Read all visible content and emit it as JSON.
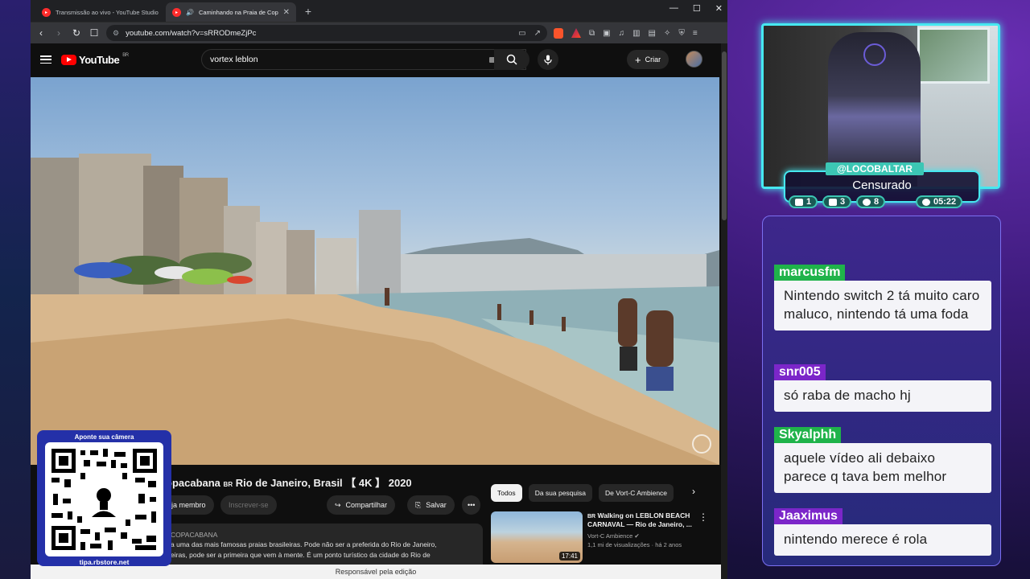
{
  "browser": {
    "tabs": [
      {
        "title": "Transmissão ao vivo - YouTube Studio",
        "active": false
      },
      {
        "title": "Caminhando na Praia de Copacabana",
        "active": true
      }
    ],
    "url": "youtube.com/watch?v=sRRODmeZjPc"
  },
  "youtube": {
    "logo_text": "YouTube",
    "region": "BR",
    "search_value": "vortex leblon",
    "create_label": "Criar",
    "video": {
      "title_prefix": "opacabana",
      "title_flag": "BR",
      "title_suffix": "Rio de Janeiro, Brasil 【 4K 】 2020",
      "member_label": "eja membro",
      "subscribe_label": "Inscrever-se",
      "share_label": "Compartilhar",
      "save_label": "Salvar",
      "desc_channel": "COPACABANA",
      "desc_line1": "a uma das mais famosas praias brasileiras. Pode não ser a preferida do Rio de Janeiro,",
      "desc_line2": "eiras, pode ser a primeira que vem à mente. É um ponto turístico da cidade do Rio de"
    },
    "chips": [
      "Todos",
      "Da sua pesquisa",
      "De Vort-C Ambience"
    ],
    "recommendation": {
      "flag": "BR",
      "title": "Walking on LEBLON BEACH CARNAVAL — Rio de Janeiro, ...",
      "channel": "Vort-C Ambience",
      "meta": "1,1 mi de visualizações · há 2 anos",
      "duration": "17:41"
    },
    "footer": "Responsável pela edição"
  },
  "qr": {
    "top_text": "Aponte sua câmera",
    "bottom_text": "tipa.rbstore.net"
  },
  "stream": {
    "handle": "@LOCOBALTAR",
    "status": "Censurado",
    "stats": [
      {
        "icon": "twitch-icon",
        "value": "1"
      },
      {
        "icon": "youtube-icon",
        "value": "3"
      },
      {
        "icon": "kick-icon",
        "value": "8"
      },
      {
        "icon": "clock-icon",
        "value": "05:22"
      }
    ],
    "accent": "#46e8f0"
  },
  "chat": [
    {
      "user": "marcusfm",
      "color": "#1fb34a",
      "text": "Nintendo switch 2 tá muito caro maluco, nintendo tá uma foda"
    },
    {
      "user": "snr005",
      "color": "#7b26c9",
      "text": "só raba de macho hj"
    },
    {
      "user": "Skyalphh",
      "color": "#1fb34a",
      "text": "aquele vídeo ali debaixo parece q tava bem melhor"
    },
    {
      "user": "Jaaximus",
      "color": "#7b26c9",
      "text": "nintendo merece é rola"
    }
  ]
}
